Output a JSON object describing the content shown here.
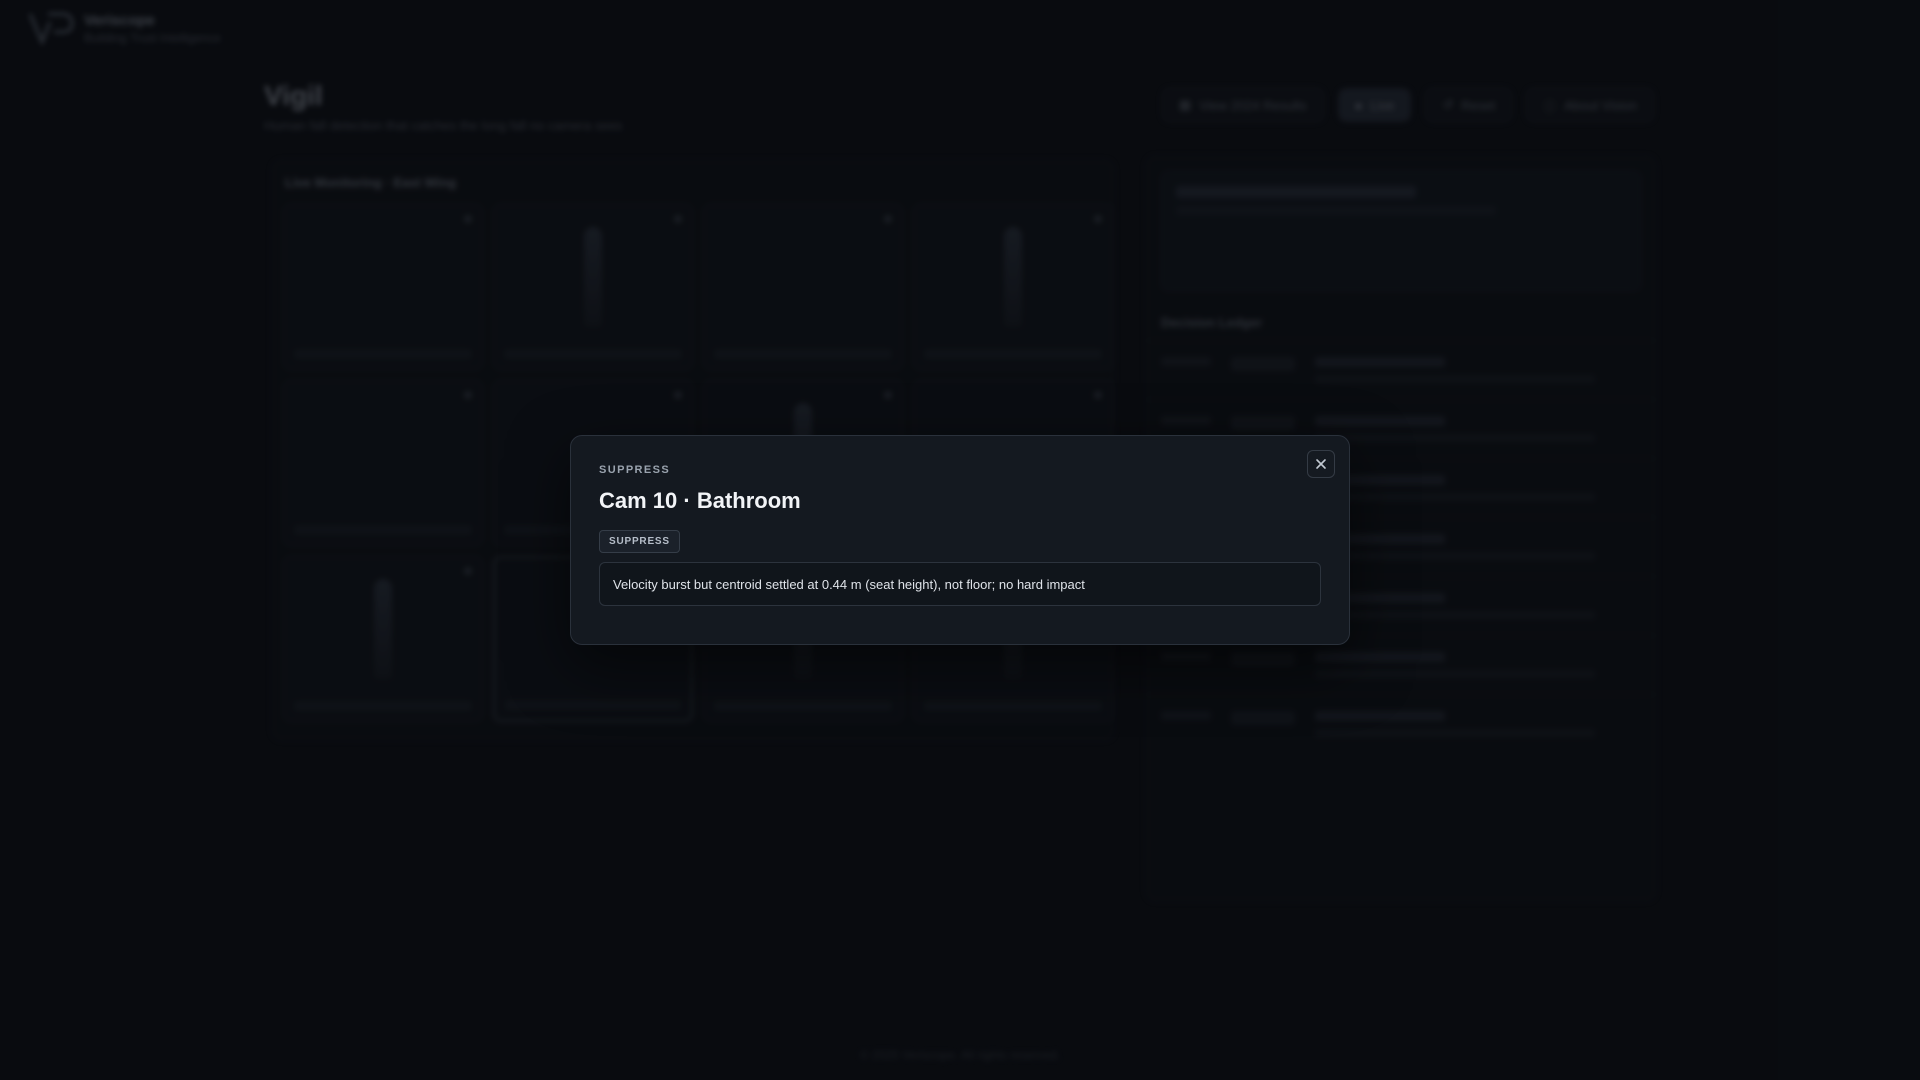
{
  "app": {
    "brand_name": "Veriscope",
    "brand_tagline": "Building Trust Intelligence"
  },
  "page": {
    "title": "Vigil",
    "subtitle": "Human fall detection that catches the long fall no camera sees"
  },
  "toolbar": {
    "buttons": [
      {
        "label": "View 2024 Results"
      },
      {
        "label": "Live"
      },
      {
        "label": "Reset"
      },
      {
        "label": "About Vision"
      }
    ]
  },
  "monitoring": {
    "title": "Live Monitoring · East Wing"
  },
  "ledger": {
    "title": "Decision Ledger"
  },
  "footer": {
    "text": "© 2025 Veriscope. All rights reserved."
  },
  "modal": {
    "kicker": "SUPPRESS",
    "title": "Cam 10 · Bathroom",
    "badge": "SUPPRESS",
    "reason": "Velocity burst but centroid settled at 0.44 m (seat height), not floor; no hard impact",
    "close_icon": "close-icon"
  }
}
